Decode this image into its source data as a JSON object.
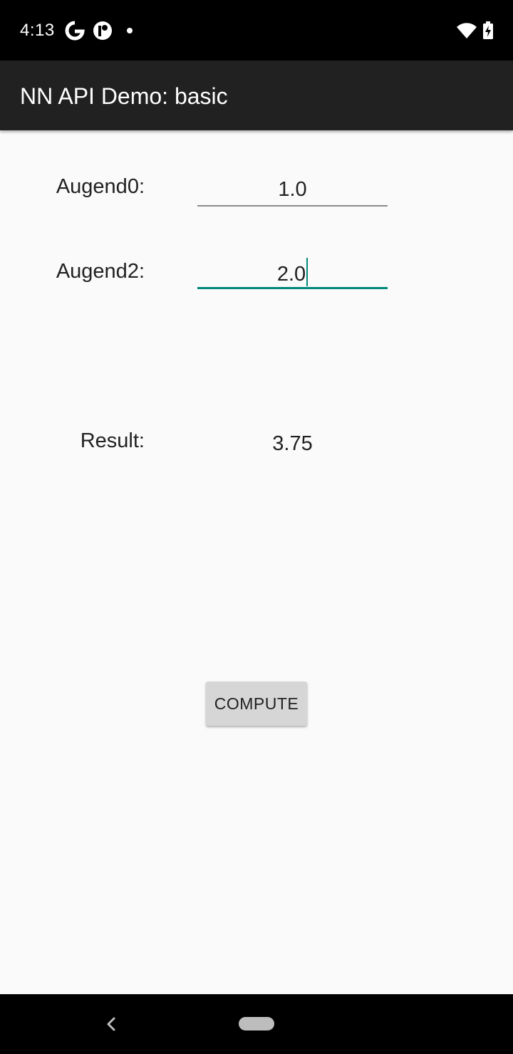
{
  "status_bar": {
    "time": "4:13",
    "icons": [
      "google-icon",
      "app-notification-icon",
      "dot-icon",
      "wifi-icon",
      "battery-charging-icon"
    ]
  },
  "app_bar": {
    "title": "NN API Demo: basic"
  },
  "form": {
    "augend0": {
      "label": "Augend0:",
      "value": "1.0"
    },
    "augend2": {
      "label": "Augend2:",
      "value": "2.0",
      "focused": true
    },
    "result": {
      "label": "Result:",
      "value": "3.75"
    }
  },
  "compute_button": {
    "label": "COMPUTE"
  },
  "nav_bar": {
    "icons": [
      "back-icon",
      "home-pill-icon"
    ]
  },
  "colors": {
    "accent": "#00897b",
    "app_bar": "#212121",
    "background": "#fafafa",
    "button": "#d6d6d6"
  }
}
